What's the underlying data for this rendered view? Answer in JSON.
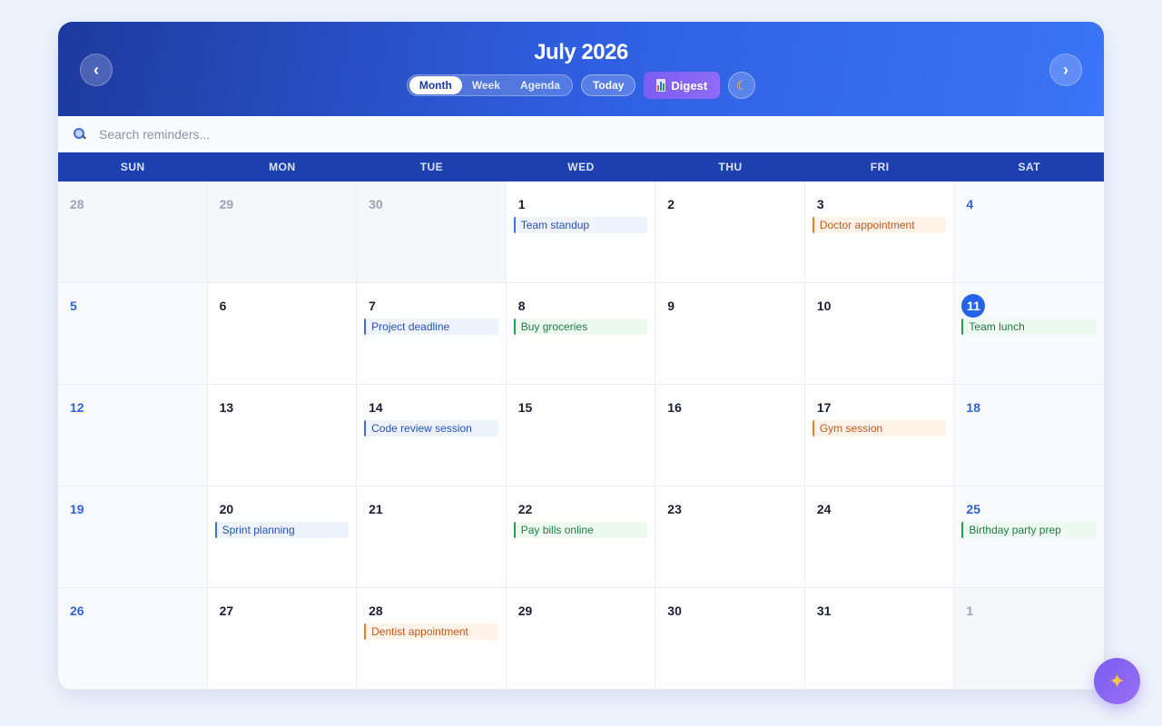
{
  "header": {
    "title": "July 2026",
    "prev_label": "‹",
    "next_label": "›",
    "views": [
      "Month",
      "Week",
      "Agenda"
    ],
    "active_view": "Month",
    "today_label": "Today",
    "digest_label": "Digest",
    "digest_icon": "bar-chart-icon",
    "theme_icon": "moon-icon"
  },
  "search": {
    "placeholder": "Search reminders...",
    "value": ""
  },
  "weekdays": [
    "SUN",
    "MON",
    "TUE",
    "WED",
    "THU",
    "FRI",
    "SAT"
  ],
  "days": [
    {
      "n": "28",
      "other": true
    },
    {
      "n": "29",
      "other": true
    },
    {
      "n": "30",
      "other": true
    },
    {
      "n": "1",
      "event": {
        "label": "Team standup",
        "color": "blue"
      }
    },
    {
      "n": "2"
    },
    {
      "n": "3",
      "event": {
        "label": "Doctor appointment",
        "color": "orange"
      }
    },
    {
      "n": "4"
    },
    {
      "n": "5"
    },
    {
      "n": "6"
    },
    {
      "n": "7",
      "event": {
        "label": "Project deadline",
        "color": "blue"
      }
    },
    {
      "n": "8",
      "event": {
        "label": "Buy groceries",
        "color": "green"
      }
    },
    {
      "n": "9"
    },
    {
      "n": "10"
    },
    {
      "n": "11",
      "today": true,
      "event": {
        "label": "Team lunch",
        "color": "green"
      }
    },
    {
      "n": "12"
    },
    {
      "n": "13"
    },
    {
      "n": "14",
      "event": {
        "label": "Code review session",
        "color": "blue"
      }
    },
    {
      "n": "15"
    },
    {
      "n": "16"
    },
    {
      "n": "17",
      "event": {
        "label": "Gym session",
        "color": "orange"
      }
    },
    {
      "n": "18"
    },
    {
      "n": "19"
    },
    {
      "n": "20",
      "event": {
        "label": "Sprint planning",
        "color": "blue"
      }
    },
    {
      "n": "21"
    },
    {
      "n": "22",
      "event": {
        "label": "Pay bills online",
        "color": "green"
      }
    },
    {
      "n": "23"
    },
    {
      "n": "24"
    },
    {
      "n": "25",
      "event": {
        "label": "Birthday party prep",
        "color": "green"
      }
    },
    {
      "n": "26"
    },
    {
      "n": "27"
    },
    {
      "n": "28",
      "event": {
        "label": "Dentist appointment",
        "color": "orange"
      }
    },
    {
      "n": "29"
    },
    {
      "n": "30"
    },
    {
      "n": "31"
    },
    {
      "n": "1",
      "other": true
    }
  ],
  "colors": {
    "blue": "#3b6fdc",
    "green": "#2a9d55",
    "orange": "#ea7a2c",
    "today": "#2563eb",
    "header_bar": "#1e40af"
  },
  "fab_icon": "sparkles-icon"
}
